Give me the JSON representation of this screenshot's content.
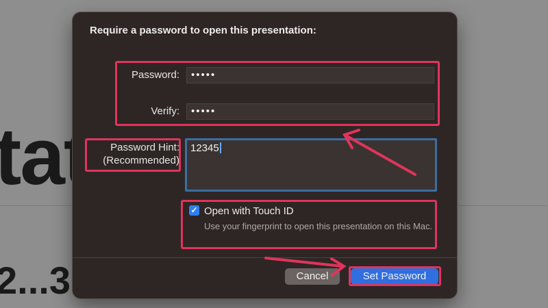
{
  "background": {
    "large_text": "tat",
    "small_text": "2...3"
  },
  "dialog": {
    "title": "Require a password to open this presentation:",
    "password_label": "Password:",
    "password_value": "•••••",
    "verify_label": "Verify:",
    "verify_value": "•••••",
    "hint_label_line1": "Password Hint:",
    "hint_label_line2": "(Recommended)",
    "hint_value": "12345",
    "touch_id_label": "Open with Touch ID",
    "touch_id_checked": true,
    "touch_id_description": "Use your fingerprint to open this presentation on this Mac.",
    "cancel_label": "Cancel",
    "set_password_label": "Set Password"
  },
  "colors": {
    "highlight": "#e0345c",
    "primary_button": "#2f6fe0",
    "focus_ring": "#3b6fa3",
    "dialog_bg": "#2e2625"
  },
  "icons": {
    "checkbox": "checkmark-icon"
  }
}
